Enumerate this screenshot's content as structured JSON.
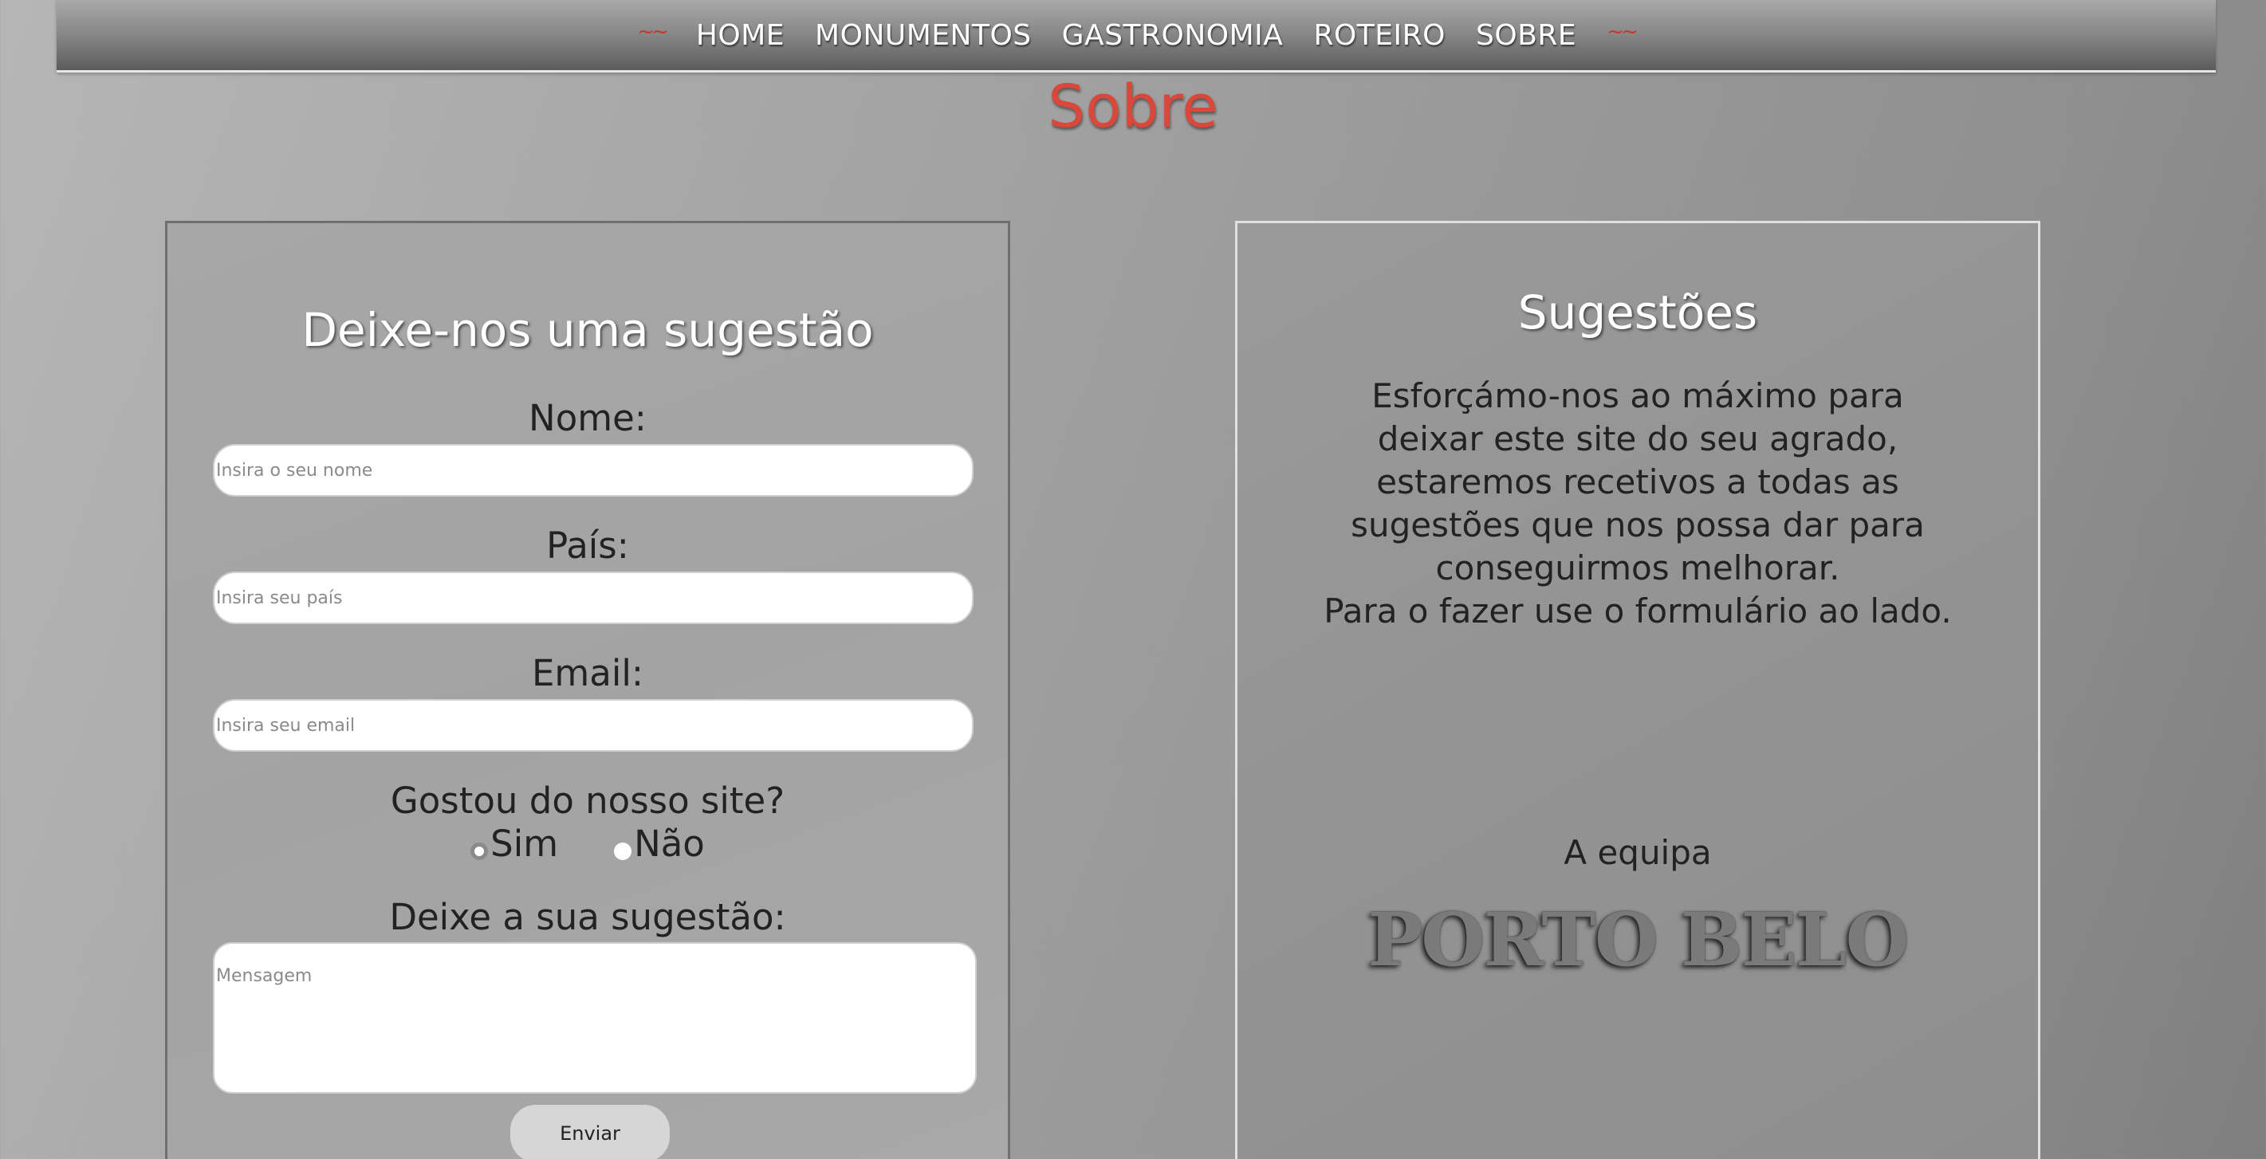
{
  "nav": {
    "left_deco": "~~",
    "right_deco": "~~",
    "items": [
      {
        "label": "HOME"
      },
      {
        "label": "MONUMENTOS"
      },
      {
        "label": "GASTRONOMIA"
      },
      {
        "label": "ROTEIRO"
      },
      {
        "label": "SOBRE"
      }
    ]
  },
  "page": {
    "title": "Sobre"
  },
  "form": {
    "heading": "Deixe-nos uma sugestão",
    "name_label": "Nome:",
    "name_placeholder": "Insira o seu nome",
    "country_label": "País:",
    "country_placeholder": "Insira seu país",
    "email_label": "Email:",
    "email_placeholder": "Insira seu email",
    "liked_question": "Gostou do nosso site?",
    "option_yes": "Sim",
    "option_no": "Não",
    "selected_option": "Sim",
    "suggestion_label": "Deixe a sua sugestão:",
    "message_placeholder": "Mensagem",
    "submit_label": "Enviar"
  },
  "info": {
    "heading": "Sugestões",
    "lines": [
      "Esforçámo-nos ao máximo para",
      "deixar este site do seu agrado,",
      "estaremos recetivos a todas as",
      "sugestões que nos possa dar para",
      "conseguirmos melhorar.",
      "Para o fazer use o formulário ao lado."
    ],
    "team_label": "A equipa",
    "brand": "PORTO BELO"
  },
  "colors": {
    "title_accent": "#d9483b",
    "nav_deco": "#c0392b"
  }
}
